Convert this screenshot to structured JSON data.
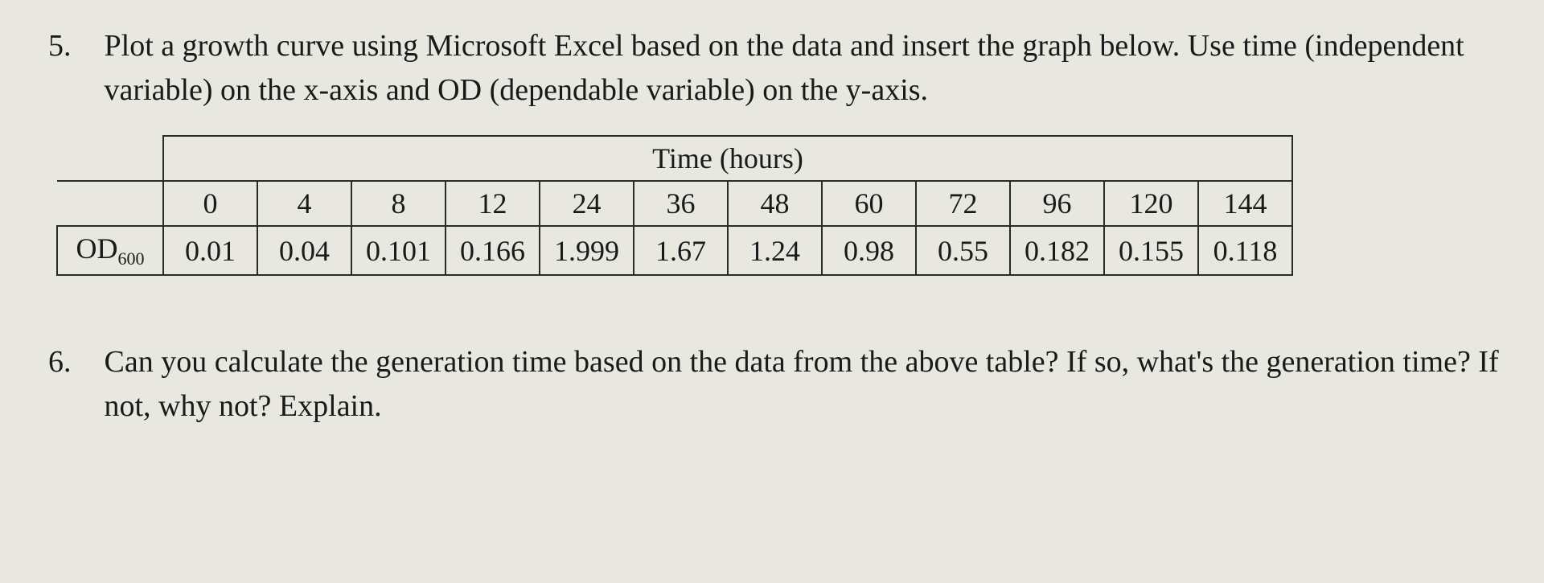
{
  "questions": {
    "q5": {
      "number": "5.",
      "text": "Plot a growth curve using Microsoft Excel based on the data and insert the graph below. Use time (independent variable) on the x-axis and OD (dependable variable) on the y-axis."
    },
    "q6": {
      "number": "6.",
      "text": "Can you calculate the generation time based on the data from the above table? If so, what's the generation time? If not, why not? Explain."
    }
  },
  "table": {
    "time_header": "Time (hours)",
    "row_label_prefix": "OD",
    "row_label_sub": "600",
    "times": [
      "0",
      "4",
      "8",
      "12",
      "24",
      "36",
      "48",
      "60",
      "72",
      "96",
      "120",
      "144"
    ],
    "values": [
      "0.01",
      "0.04",
      "0.101",
      "0.166",
      "1.999",
      "1.67",
      "1.24",
      "0.98",
      "0.55",
      "0.182",
      "0.155",
      "0.118"
    ]
  },
  "chart_data": {
    "type": "table",
    "title": "Growth curve data (OD600 vs Time)",
    "xlabel": "Time (hours)",
    "ylabel": "OD600",
    "x": [
      0,
      4,
      8,
      12,
      24,
      36,
      48,
      60,
      72,
      96,
      120,
      144
    ],
    "series": [
      {
        "name": "OD600",
        "values": [
          0.01,
          0.04,
          0.101,
          0.166,
          1.999,
          1.67,
          1.24,
          0.98,
          0.55,
          0.182,
          0.155,
          0.118
        ]
      }
    ]
  }
}
